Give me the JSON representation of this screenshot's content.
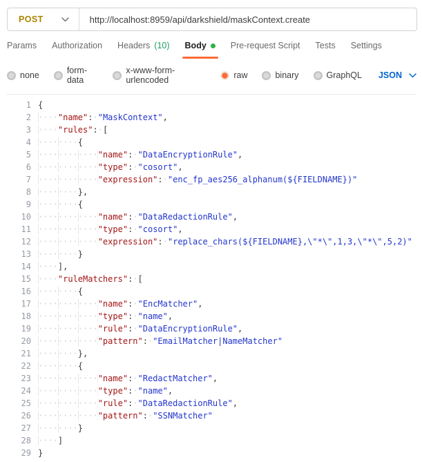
{
  "request": {
    "method": "POST",
    "url": "http://localhost:8959/api/darkshield/maskContext.create"
  },
  "tabs": {
    "active": "Body",
    "items": [
      {
        "label": "Params"
      },
      {
        "label": "Authorization"
      },
      {
        "label": "Headers",
        "count": "(10)"
      },
      {
        "label": "Body",
        "dot": true
      },
      {
        "label": "Pre-request Script"
      },
      {
        "label": "Tests"
      },
      {
        "label": "Settings"
      }
    ]
  },
  "body_modes": {
    "options": [
      "none",
      "form-data",
      "x-www-form-urlencoded",
      "raw",
      "binary",
      "GraphQL"
    ],
    "selected": "raw",
    "language": "JSON"
  },
  "colors": {
    "accent_orange": "#ff6c37",
    "method_post": "#ae8402",
    "link_blue": "#0265d2",
    "headers_count_green": "#1d9e63",
    "body_dot_green": "#2fb344",
    "json_key": "#a31515",
    "json_string": "#2336cc"
  },
  "editor": {
    "lines": [
      {
        "num": 1,
        "segs": [
          [
            "pn",
            "{"
          ]
        ]
      },
      {
        "num": 2,
        "segs": [
          [
            "ws",
            4
          ],
          [
            "key",
            "\"name\""
          ],
          [
            "pn",
            ":"
          ],
          [
            "ws",
            1
          ],
          [
            "str",
            "\"MaskContext\""
          ],
          [
            "pn",
            ","
          ]
        ]
      },
      {
        "num": 3,
        "segs": [
          [
            "ws",
            4
          ],
          [
            "key",
            "\"rules\""
          ],
          [
            "pn",
            ":"
          ],
          [
            "ws",
            1
          ],
          [
            "pn",
            "["
          ]
        ]
      },
      {
        "num": 4,
        "segs": [
          [
            "ws",
            8
          ],
          [
            "pn",
            "{"
          ]
        ]
      },
      {
        "num": 5,
        "segs": [
          [
            "ws",
            12
          ],
          [
            "key",
            "\"name\""
          ],
          [
            "pn",
            ":"
          ],
          [
            "ws",
            1
          ],
          [
            "str",
            "\"DataEncryptionRule\""
          ],
          [
            "pn",
            ","
          ]
        ]
      },
      {
        "num": 6,
        "segs": [
          [
            "ws",
            12
          ],
          [
            "key",
            "\"type\""
          ],
          [
            "pn",
            ":"
          ],
          [
            "ws",
            1
          ],
          [
            "str",
            "\"cosort\""
          ],
          [
            "pn",
            ","
          ]
        ]
      },
      {
        "num": 7,
        "segs": [
          [
            "ws",
            12
          ],
          [
            "key",
            "\"expression\""
          ],
          [
            "pn",
            ":"
          ],
          [
            "ws",
            1
          ],
          [
            "str",
            "\"enc_fp_aes256_alphanum(${FIELDNAME})\""
          ]
        ]
      },
      {
        "num": 8,
        "segs": [
          [
            "ws",
            8
          ],
          [
            "pn",
            "},"
          ]
        ]
      },
      {
        "num": 9,
        "segs": [
          [
            "ws",
            8
          ],
          [
            "pn",
            "{"
          ]
        ]
      },
      {
        "num": 10,
        "segs": [
          [
            "ws",
            12
          ],
          [
            "key",
            "\"name\""
          ],
          [
            "pn",
            ":"
          ],
          [
            "ws",
            1
          ],
          [
            "str",
            "\"DataRedactionRule\""
          ],
          [
            "pn",
            ","
          ]
        ]
      },
      {
        "num": 11,
        "segs": [
          [
            "ws",
            12
          ],
          [
            "key",
            "\"type\""
          ],
          [
            "pn",
            ":"
          ],
          [
            "ws",
            1
          ],
          [
            "str",
            "\"cosort\""
          ],
          [
            "pn",
            ","
          ]
        ]
      },
      {
        "num": 12,
        "segs": [
          [
            "ws",
            12
          ],
          [
            "key",
            "\"expression\""
          ],
          [
            "pn",
            ":"
          ],
          [
            "ws",
            1
          ],
          [
            "str",
            "\"replace_chars(${FIELDNAME},\\\"*\\\",1,3,\\\"*\\\",5,2)\""
          ]
        ]
      },
      {
        "num": 13,
        "segs": [
          [
            "ws",
            8
          ],
          [
            "pn",
            "}"
          ]
        ]
      },
      {
        "num": 14,
        "segs": [
          [
            "ws",
            4
          ],
          [
            "pn",
            "],"
          ]
        ]
      },
      {
        "num": 15,
        "segs": [
          [
            "ws",
            4
          ],
          [
            "key",
            "\"ruleMatchers\""
          ],
          [
            "pn",
            ":"
          ],
          [
            "ws",
            1
          ],
          [
            "pn",
            "["
          ]
        ]
      },
      {
        "num": 16,
        "segs": [
          [
            "ws",
            8
          ],
          [
            "pn",
            "{"
          ]
        ]
      },
      {
        "num": 17,
        "segs": [
          [
            "ws",
            12
          ],
          [
            "key",
            "\"name\""
          ],
          [
            "pn",
            ":"
          ],
          [
            "ws",
            1
          ],
          [
            "str",
            "\"EncMatcher\""
          ],
          [
            "pn",
            ","
          ]
        ]
      },
      {
        "num": 18,
        "segs": [
          [
            "ws",
            12
          ],
          [
            "key",
            "\"type\""
          ],
          [
            "pn",
            ":"
          ],
          [
            "ws",
            1
          ],
          [
            "str",
            "\"name\""
          ],
          [
            "pn",
            ","
          ]
        ]
      },
      {
        "num": 19,
        "segs": [
          [
            "ws",
            12
          ],
          [
            "key",
            "\"rule\""
          ],
          [
            "pn",
            ":"
          ],
          [
            "ws",
            1
          ],
          [
            "str",
            "\"DataEncryptionRule\""
          ],
          [
            "pn",
            ","
          ]
        ]
      },
      {
        "num": 20,
        "segs": [
          [
            "ws",
            12
          ],
          [
            "key",
            "\"pattern\""
          ],
          [
            "pn",
            ":"
          ],
          [
            "ws",
            1
          ],
          [
            "str",
            "\"EmailMatcher|NameMatcher\""
          ]
        ]
      },
      {
        "num": 21,
        "segs": [
          [
            "ws",
            8
          ],
          [
            "pn",
            "},"
          ]
        ]
      },
      {
        "num": 22,
        "segs": [
          [
            "ws",
            8
          ],
          [
            "pn",
            "{"
          ]
        ]
      },
      {
        "num": 23,
        "segs": [
          [
            "ws",
            12
          ],
          [
            "key",
            "\"name\""
          ],
          [
            "pn",
            ":"
          ],
          [
            "ws",
            1
          ],
          [
            "str",
            "\"RedactMatcher\""
          ],
          [
            "pn",
            ","
          ]
        ]
      },
      {
        "num": 24,
        "segs": [
          [
            "ws",
            12
          ],
          [
            "key",
            "\"type\""
          ],
          [
            "pn",
            ":"
          ],
          [
            "ws",
            1
          ],
          [
            "str",
            "\"name\""
          ],
          [
            "pn",
            ","
          ]
        ]
      },
      {
        "num": 25,
        "segs": [
          [
            "ws",
            12
          ],
          [
            "key",
            "\"rule\""
          ],
          [
            "pn",
            ":"
          ],
          [
            "ws",
            1
          ],
          [
            "str",
            "\"DataRedactionRule\""
          ],
          [
            "pn",
            ","
          ]
        ]
      },
      {
        "num": 26,
        "segs": [
          [
            "ws",
            12
          ],
          [
            "key",
            "\"pattern\""
          ],
          [
            "pn",
            ":"
          ],
          [
            "ws",
            1
          ],
          [
            "str",
            "\"SSNMatcher\""
          ]
        ]
      },
      {
        "num": 27,
        "segs": [
          [
            "ws",
            8
          ],
          [
            "pn",
            "}"
          ]
        ]
      },
      {
        "num": 28,
        "segs": [
          [
            "ws",
            4
          ],
          [
            "pn",
            "]"
          ]
        ]
      },
      {
        "num": 29,
        "segs": [
          [
            "pn",
            "}"
          ]
        ]
      }
    ]
  }
}
